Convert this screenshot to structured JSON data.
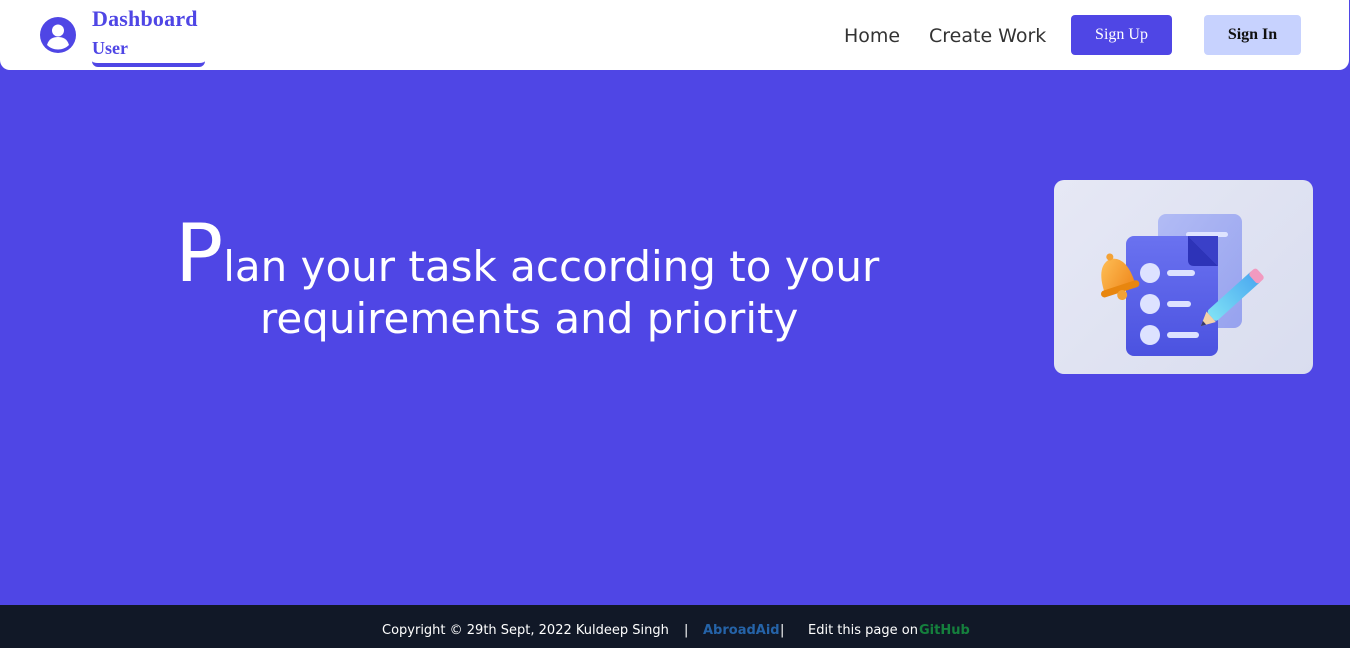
{
  "header": {
    "brand_title": "Dashboard",
    "brand_subtitle": "User",
    "nav": {
      "home": "Home",
      "create_work": "Create Work"
    },
    "sign_up_label": "Sign Up",
    "sign_in_label": "Sign In"
  },
  "hero": {
    "headline_cap": "P",
    "headline_rest": "lan your task according to your",
    "headline_line2": "requirements and priority",
    "illustration_icon": "task-list-illustration"
  },
  "footer": {
    "copyright": "Copyright © 29th Sept, 2022 Kuldeep Singh",
    "separator": "|",
    "abroadaid_link": "AbroadAid",
    "edit_text": "Edit this page on",
    "github_link": "GitHub"
  },
  "colors": {
    "primary": "#4f46e5",
    "secondary_button": "#c7d2fe",
    "footer_bg": "#111827",
    "abroadaid_link": "#2563a8",
    "github_link": "#15803d"
  }
}
